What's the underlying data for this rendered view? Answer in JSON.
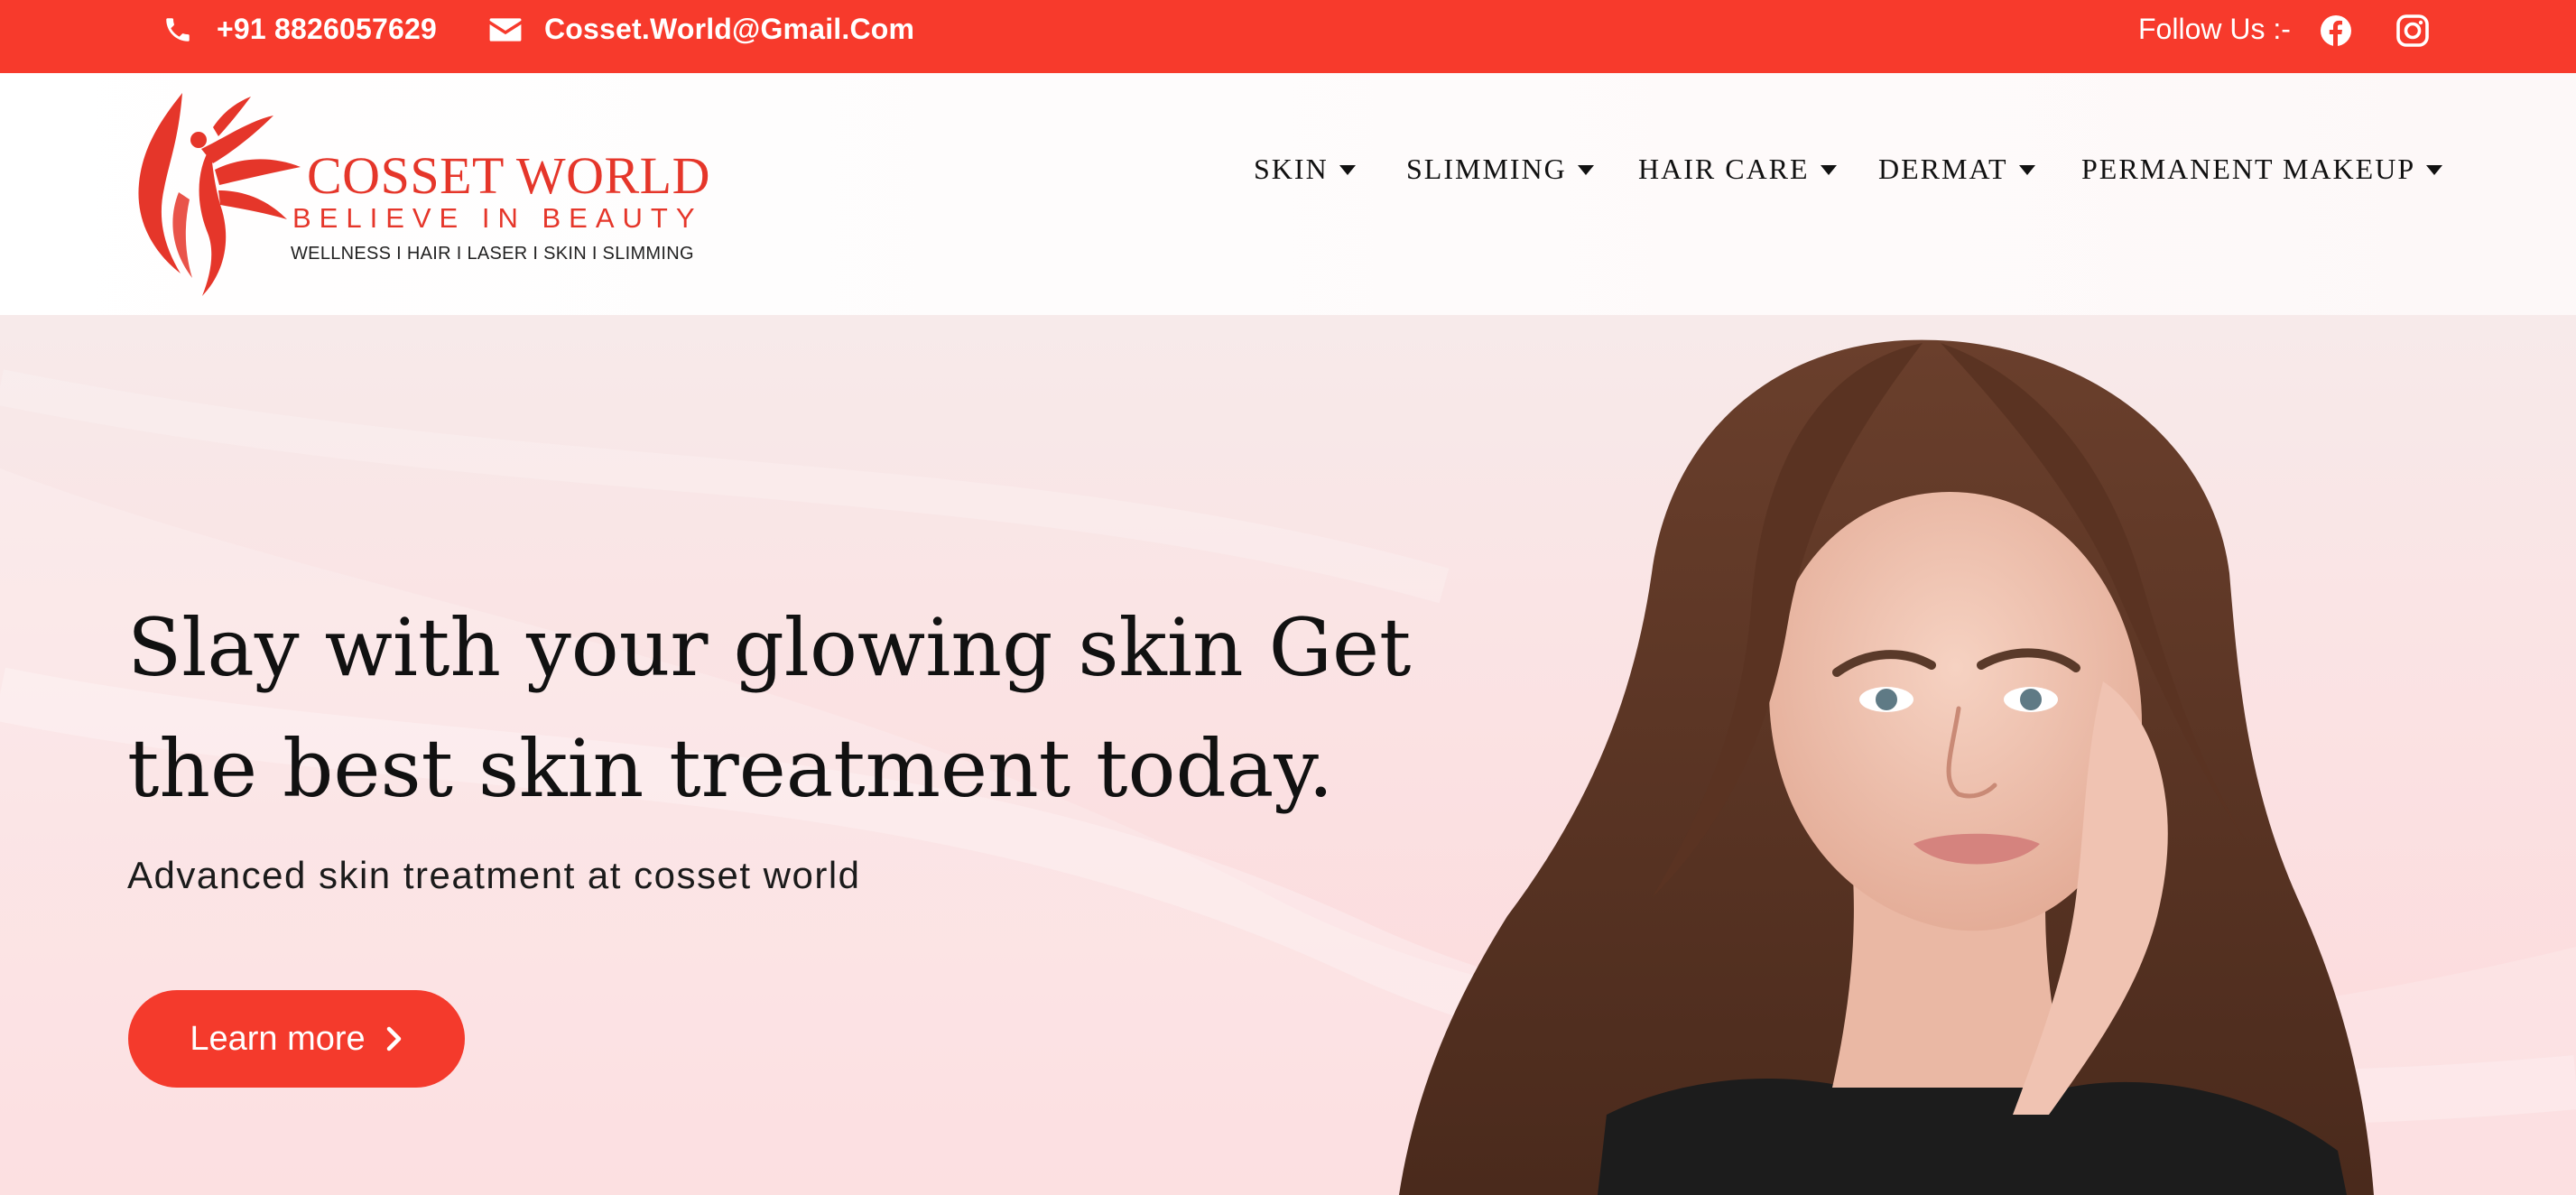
{
  "topbar": {
    "phone": "+91 8826057629",
    "email": "Cosset.World@Gmail.Com",
    "follow_label": "Follow Us :-",
    "icons": [
      "phone-icon",
      "envelope-icon",
      "facebook-icon",
      "instagram-icon"
    ],
    "background_color": "#f73a2c"
  },
  "header": {
    "logo": {
      "brand": "COSSET WORLD",
      "tagline": "BELIEVE IN BEAUTY",
      "services": "WELLNESS  I  HAIR  I  LASER   I   SKIN   I  SLIMMING"
    },
    "nav": [
      {
        "label": "SKIN"
      },
      {
        "label": "SLIMMING"
      },
      {
        "label": "HAIR CARE"
      },
      {
        "label": "DERMAT"
      },
      {
        "label": "PERMANENT MAKEUP"
      }
    ]
  },
  "hero": {
    "title_line1": "Slay with your glowing skin Get",
    "title_line2": "the best skin treatment today.",
    "subtitle": "Advanced skin treatment at cosset world",
    "cta_label": "Learn more",
    "accent_color": "#f43a2c"
  }
}
